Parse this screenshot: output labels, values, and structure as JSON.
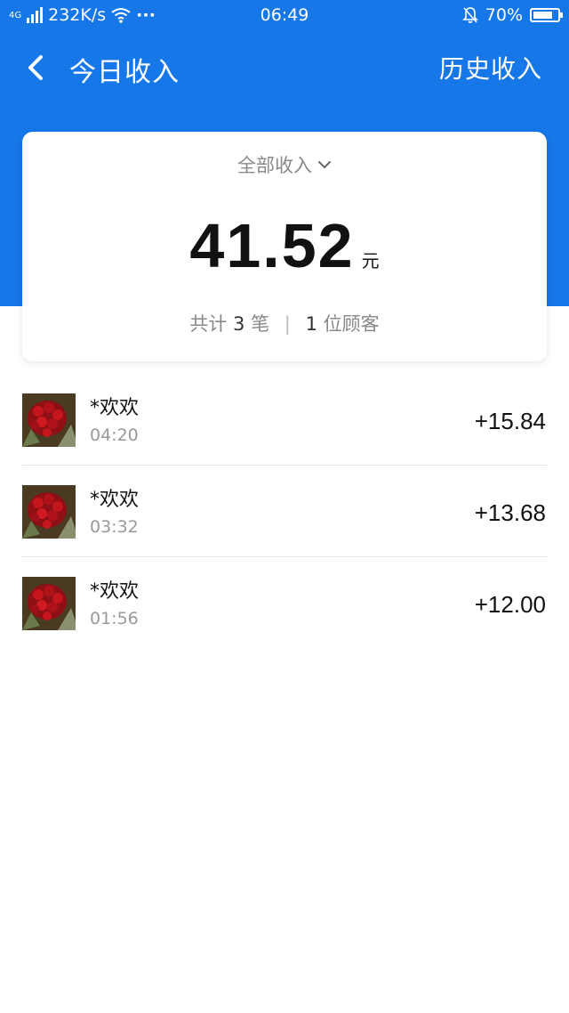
{
  "status_bar": {
    "network": "4G",
    "speed": "232K/s",
    "dots": "···",
    "time": "06:49",
    "battery": "70%",
    "icons": [
      "signal-icon",
      "wifi-icon",
      "bell-muted-icon",
      "battery-icon"
    ]
  },
  "nav": {
    "back_icon": "chevron-left-icon",
    "title": "今日收入",
    "right_link": "历史收入"
  },
  "summary": {
    "filter_label": "全部收入",
    "filter_icon": "chevron-down-icon",
    "amount": "41.52",
    "unit": "元",
    "count_prefix": "共计",
    "count": "3",
    "count_suffix": "笔",
    "separator": "|",
    "customers": "1",
    "customers_suffix": "位顾客"
  },
  "transactions": [
    {
      "name": "*欢欢",
      "time": "04:20",
      "amount": "+15.84"
    },
    {
      "name": "*欢欢",
      "time": "03:32",
      "amount": "+13.68"
    },
    {
      "name": "*欢欢",
      "time": "01:56",
      "amount": "+12.00"
    }
  ],
  "colors": {
    "header_blue": "#1677e8",
    "text_dark": "#111111",
    "text_gray": "#888888"
  }
}
